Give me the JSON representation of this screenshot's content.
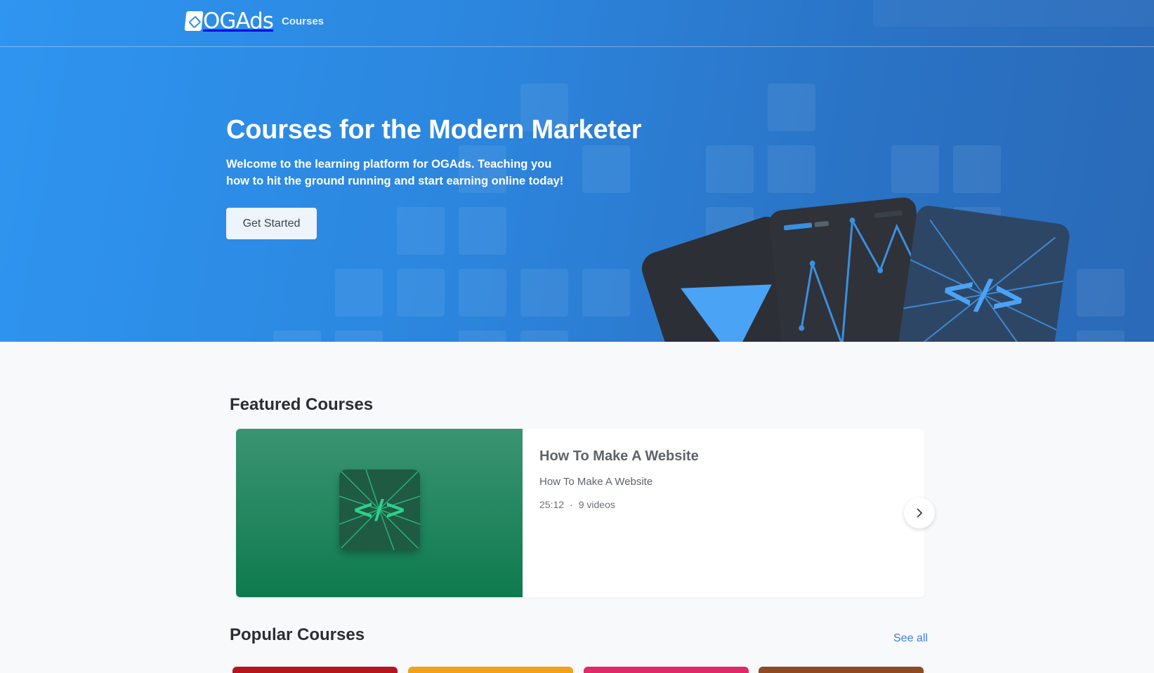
{
  "header": {
    "logo_text": "OGAds",
    "nav_courses": "Courses"
  },
  "hero": {
    "title": "Courses for the Modern Marketer",
    "subtitle": "Welcome to the learning platform for OGAds. Teaching you how to hit the ground running and start earning online today!",
    "cta_label": "Get Started"
  },
  "featured": {
    "section_title": "Featured Courses",
    "course": {
      "title": "How To Make A Website",
      "description": "How To Make A Website",
      "duration": "25:12",
      "separator": "·",
      "video_count": "9 videos",
      "thumb_icon": "code-icon",
      "thumb_colors": [
        "#3a9472",
        "#0e7a4e"
      ]
    },
    "next_icon": "chevron-right-icon"
  },
  "popular": {
    "section_title": "Popular Courses",
    "see_all_label": "See all",
    "card_colors": [
      "#b4151f",
      "#f0a21a",
      "#e02a68",
      "#8e4a22"
    ]
  },
  "colors": {
    "hero_start": "#2e95f0",
    "hero_end": "#2a6ab8",
    "link": "#3f7ee0",
    "page_bg": "#f7f9fb"
  }
}
